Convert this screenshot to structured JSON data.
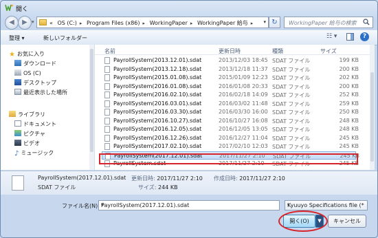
{
  "window": {
    "title": "開く"
  },
  "address": {
    "crumbs": [
      "«",
      "OS (C:)",
      "Program Files (x86)",
      "WorkingPaper",
      "WorkingPaper 給与"
    ]
  },
  "search": {
    "placeholder": "WorkingPaper 給与の検索"
  },
  "toolbar": {
    "organize": "整理 ▾",
    "new_folder": "新しいフォルダー"
  },
  "sidebar": {
    "favorites": "お気に入り",
    "favorite_items": [
      "ダウンロード",
      "OS (C)",
      "デスクトップ",
      "最近表示した場所"
    ],
    "libraries": "ライブラリ",
    "library_items": [
      "ドキュメント",
      "ピクチャ",
      "ビデオ",
      "ミュージック"
    ]
  },
  "columns": {
    "name": "名前",
    "date": "更新日時",
    "type": "種類",
    "size": "サイズ"
  },
  "files": [
    {
      "name": "PayrollSystem(2013.12.01).sdat",
      "date": "2013/12/03 18:45",
      "type": "SDAT ファイル",
      "size": "199 KB"
    },
    {
      "name": "PayrollSystem(2013.12.18).sdat",
      "date": "2013/12/18 11:37",
      "type": "SDAT ファイル",
      "size": "200 KB"
    },
    {
      "name": "PayrollSystem(2015.01.08).sdat",
      "date": "2015/01/09 12:23",
      "type": "SDAT ファイル",
      "size": "202 KB"
    },
    {
      "name": "PayrollSystem(2016.01.08).sdat",
      "date": "2016/01/08 20:33",
      "type": "SDAT ファイル",
      "size": "200 KB"
    },
    {
      "name": "PayrollSystem(2016.02.10).sdat",
      "date": "2016/02/18 14:09",
      "type": "SDAT ファイル",
      "size": "252 KB"
    },
    {
      "name": "PayrollSystem(2016.03.01).sdat",
      "date": "2016/03/02 11:48",
      "type": "SDAT ファイル",
      "size": "259 KB"
    },
    {
      "name": "PayrollSystem(2016.03.30).sdat",
      "date": "2016/03/30 16:00",
      "type": "SDAT ファイル",
      "size": "250 KB"
    },
    {
      "name": "PayrollSystem(2016.10.27).sdat",
      "date": "2016/10/27 16:08",
      "type": "SDAT ファイル",
      "size": "248 KB"
    },
    {
      "name": "PayrollSystem(2016.12.05).sdat",
      "date": "2016/12/05 13:05",
      "type": "SDAT ファイル",
      "size": "248 KB"
    },
    {
      "name": "PayrollSystem(2016.12.26).sdat",
      "date": "2016/12/27 11:04",
      "type": "SDAT ファイル",
      "size": "245 KB"
    },
    {
      "name": "PayrollSystem(2017.02.10).sdat",
      "date": "2017/02/10 12:03",
      "type": "SDAT ファイル",
      "size": "245 KB"
    },
    {
      "name": "PayrollSystem(2017.12.01).sdat",
      "date": "2017/11/27 2:10",
      "type": "SDAT ファイル",
      "size": "245 KB"
    },
    {
      "name": "PayrollSystem.sdat",
      "date": "2017/11/27 2:10",
      "type": "SDAT ファイル",
      "size": "245 KB"
    }
  ],
  "selected_index": 11,
  "details": {
    "name": "PayrollSystem(2017.12.01).sdat",
    "type": "SDAT ファイル",
    "modified_label": "更新日時:",
    "modified": "2017/11/27 2:10",
    "created_label": "作成日時:",
    "created": "2017/11/27 2:10",
    "size_label": "サイズ:",
    "size": "244 KB"
  },
  "footer": {
    "filename_label": "ファイル名(N):",
    "filename_value": "PayrollSystem(2017.12.01).sdat",
    "filetype": "Kyuuyo Specifications file (*",
    "open": "開く(O)",
    "cancel": "キャンセル"
  },
  "colors": {
    "highlight": "#d8232a",
    "selection": "#c4dcf8",
    "window": "#c6d7ee"
  }
}
